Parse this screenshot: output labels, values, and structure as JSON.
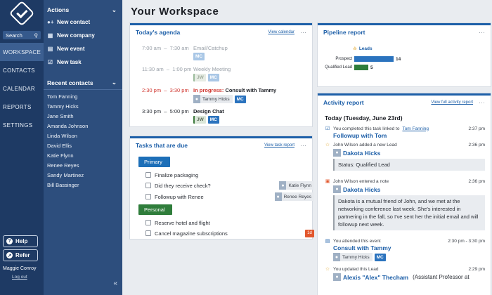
{
  "rail": {
    "search_label": "Search",
    "items": [
      {
        "label": "WORKSPACE"
      },
      {
        "label": "CONTACTS"
      },
      {
        "label": "CALENDAR"
      },
      {
        "label": "REPORTS"
      },
      {
        "label": "SETTINGS"
      }
    ],
    "help_label": "Help",
    "refer_label": "Refer",
    "user_name": "Maggie Conroy",
    "logout_label": "Log out"
  },
  "panel": {
    "actions_title": "Actions",
    "actions": [
      {
        "label": "New contact",
        "icon": "user-plus-icon"
      },
      {
        "label": "New company",
        "icon": "building-icon"
      },
      {
        "label": "New event",
        "icon": "calendar-icon"
      },
      {
        "label": "New task",
        "icon": "checkbox-icon"
      }
    ],
    "recent_title": "Recent contacts",
    "recent": [
      "Tom Fanning",
      "Tammy Hicks",
      "Jane Smith",
      "Amanda Johnson",
      "Linda Wilson",
      "David Ellis",
      "Katie Flynn",
      "Renee Reyes",
      "Sandy Martinez",
      "Bill Bassinger"
    ]
  },
  "main": {
    "title": "Your Workspace"
  },
  "agenda": {
    "title": "Today's agenda",
    "link": "View calendar",
    "items": [
      {
        "start": "7:00 am",
        "end": "7:30 am",
        "title": "Email/Catchup",
        "status": ""
      },
      {
        "start": "11:30 am",
        "end": "1:00 pm",
        "title": "Weekly Meeting",
        "status": ""
      },
      {
        "start": "2:30 pm",
        "end": "3:30 pm",
        "title": "Consult with Tammy",
        "status": "In progress:",
        "person": "Tammy Hicks"
      },
      {
        "start": "3:30 pm",
        "end": "5:00 pm",
        "title": "Design Chat",
        "status": ""
      }
    ],
    "chip_mc": "MC",
    "chip_jw": "JW"
  },
  "tasks": {
    "title": "Tasks that are due",
    "link": "View task report",
    "groups": [
      {
        "label": "Primary",
        "items": [
          {
            "label": "Finalize packaging",
            "person": ""
          },
          {
            "label": "Did they receive check?",
            "person": "Katie Flynn"
          },
          {
            "label": "Followup with Renee",
            "person": "Renee Reyes"
          }
        ]
      },
      {
        "label": "Personal",
        "items": [
          {
            "label": "Reserve hotel and flight",
            "person": ""
          },
          {
            "label": "Cancel magazine subscriptions",
            "badge": "1d"
          }
        ]
      }
    ]
  },
  "pipeline": {
    "title": "Pipeline report",
    "legend": "Leads",
    "rows": [
      {
        "label": "Prospect",
        "value": 14
      },
      {
        "label": "Qualified Lead",
        "value": 5
      }
    ],
    "colors": {
      "prospect": "#2b73be",
      "qualified": "#2f7d3b"
    }
  },
  "activity": {
    "title": "Activity report",
    "link": "View full activity report",
    "date": "Today (Tuesday, June 23rd)",
    "entries": [
      {
        "meta_pre": "You completed this task linked to",
        "meta_link": "Tom Fanning",
        "time": "2:37 pm",
        "link": "Followup with Tom"
      },
      {
        "meta_pre": "John Wilson added a new Lead",
        "time": "2:36 pm",
        "lead": "Dakota Hicks",
        "note": "Status: Qualified Lead"
      },
      {
        "meta_pre": "John Wilson entered a note",
        "time": "2:36 pm",
        "lead": "Dakota Hicks",
        "note": "Dakota is a mutual friend of John, and we met at the networking conference last week. She's interested in partnering in the fall, so I've sent her the initial email and will followup next week."
      },
      {
        "meta_pre": "You attended this event",
        "time": "2:30 pm - 3:30 pm",
        "link": "Consult with Tammy",
        "person": "Tammy Hicks",
        "chip": "MC"
      },
      {
        "meta_pre": "You updated this Lead",
        "time": "2:29 pm",
        "lead": "Alexis \"Alex\" Thecham",
        "lead_extra": "(Assistant Professor at"
      }
    ]
  }
}
